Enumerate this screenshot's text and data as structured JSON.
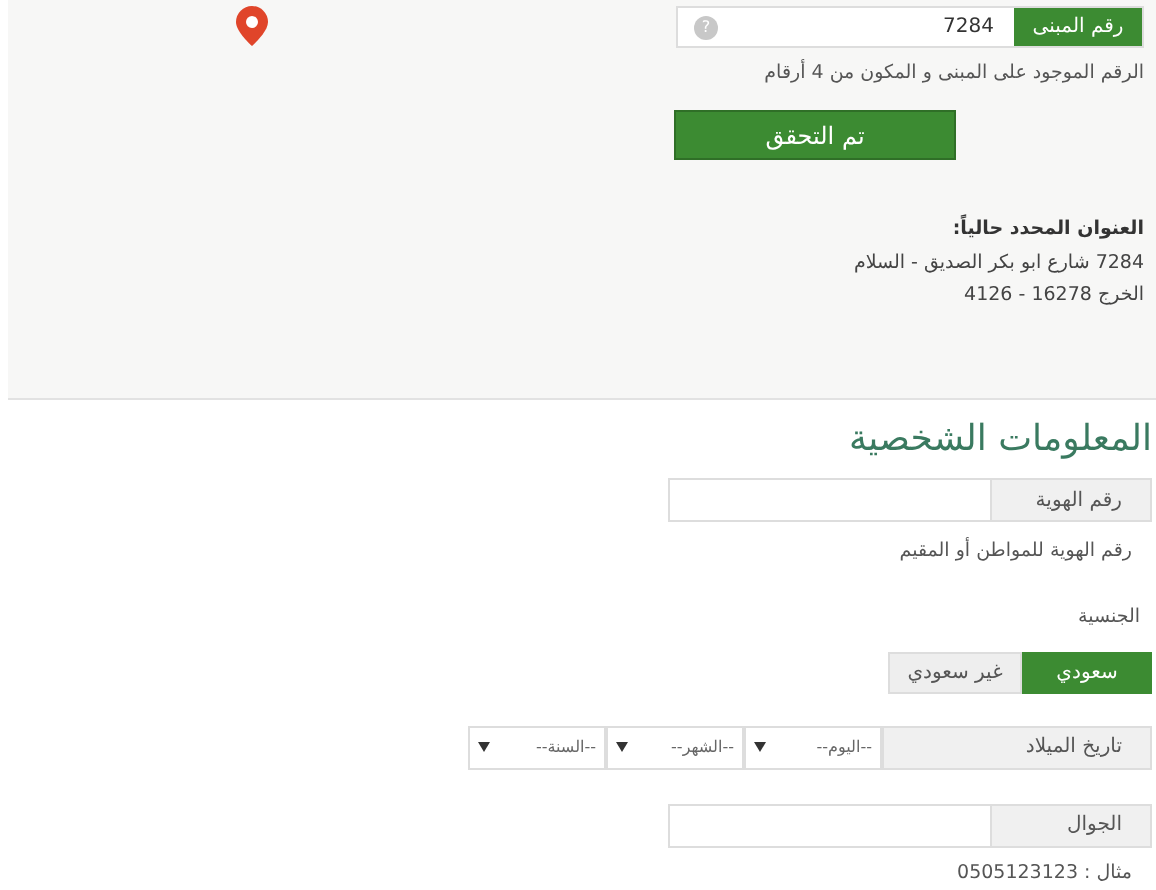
{
  "address_panel": {
    "building_number": {
      "label": "رقم المبنى",
      "value": "7284",
      "help": "?"
    },
    "building_hint": "الرقم الموجود على المبنى و المكون من 4 أرقام",
    "verify_button": "تم التحقق",
    "current_address": {
      "title": "العنوان المحدد حالياً:",
      "lines": [
        "7284 شارع ابو بكر الصديق - السلام",
        "الخرج 16278 - 4126"
      ]
    }
  },
  "personal_info": {
    "heading": "المعلومات الشخصية",
    "id_number": {
      "label": "رقم الهوية"
    },
    "id_hint": "رقم الهوية للمواطن أو المقيم",
    "nationality": {
      "label": "الجنسية",
      "options": [
        {
          "label": "سعودي",
          "selected": true
        },
        {
          "label": "غير سعودي",
          "selected": false
        }
      ]
    },
    "birth_date": {
      "label": "تاريخ الميلاد",
      "selects": [
        "--اليوم--",
        "--الشهر--",
        "--السنة--"
      ]
    },
    "mobile": {
      "label": "الجوال"
    },
    "mobile_example": "مثال : 0505123123"
  }
}
